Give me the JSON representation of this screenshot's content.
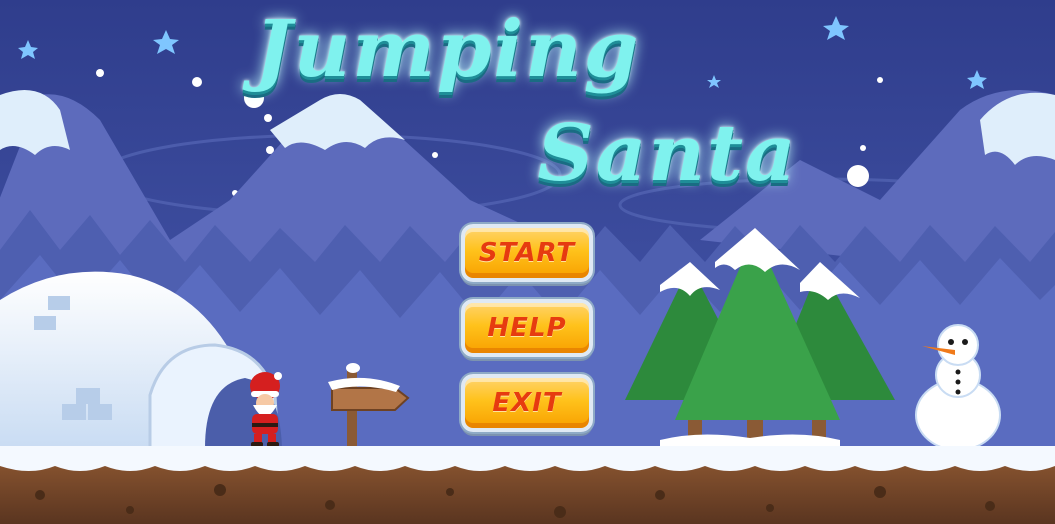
{
  "game": {
    "title_line1": "Jumping",
    "title_line2": "Santa"
  },
  "menu": {
    "start_label": "START",
    "help_label": "HELP",
    "exit_label": "EXIT"
  },
  "colors": {
    "sky": "#3f4f9e",
    "title": "#7ff2ee",
    "button": "#ffc21b",
    "button_text": "#e63b10",
    "ground": "#7a4a2a",
    "snow": "#f4f9ff"
  }
}
